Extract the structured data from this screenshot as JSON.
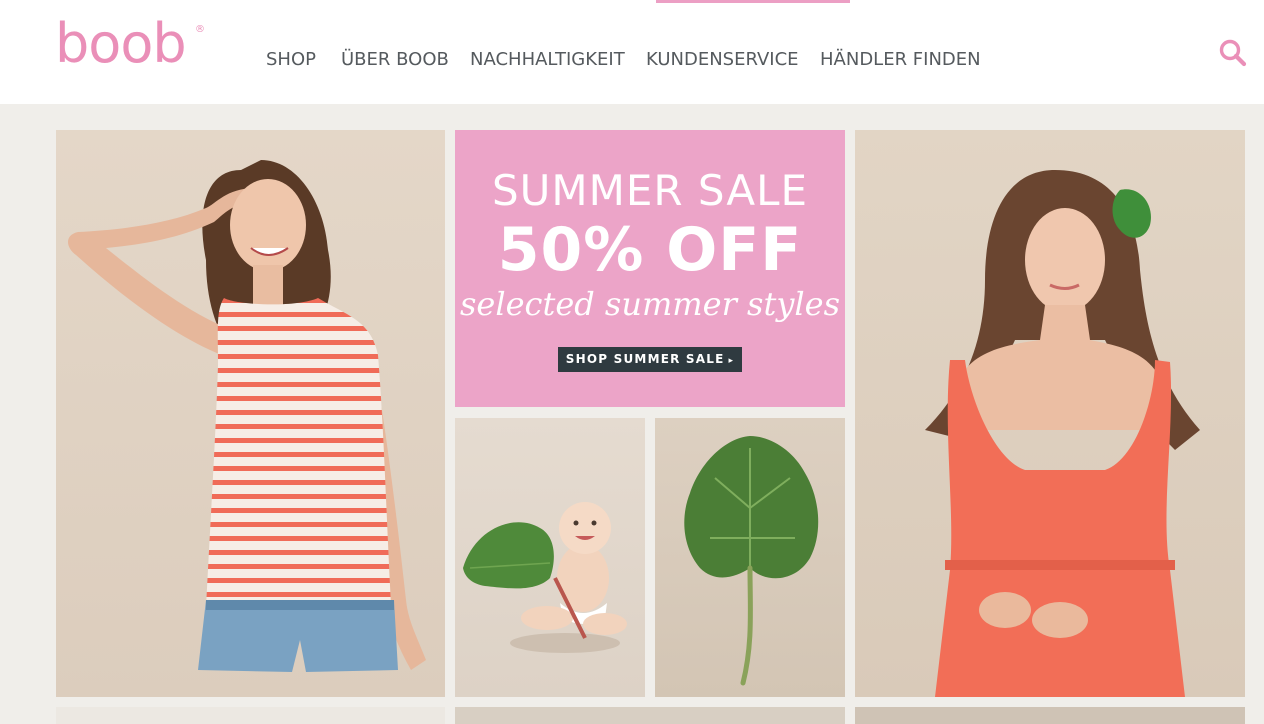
{
  "header": {
    "logo_text": "boob",
    "logo_mark": "®",
    "nav": [
      {
        "label": "SHOP"
      },
      {
        "label": "ÜBER BOOB"
      },
      {
        "label": "NACHHALTIGKEIT"
      },
      {
        "label": "KUNDENSERVICE"
      },
      {
        "label": "HÄNDLER FINDEN"
      }
    ],
    "search_icon": "search-icon"
  },
  "promo": {
    "line1": "SUMMER SALE",
    "line2": "50% OFF",
    "line3": "selected summer styles",
    "button_label": "SHOP SUMMER SALE",
    "button_arrow": "▸"
  },
  "colors": {
    "brand_pink": "#ea8fb8",
    "promo_bg": "#eca4c8",
    "button_bg": "#2f3a40",
    "nav_text": "#555a5e",
    "page_bg": "#f0eeea"
  }
}
